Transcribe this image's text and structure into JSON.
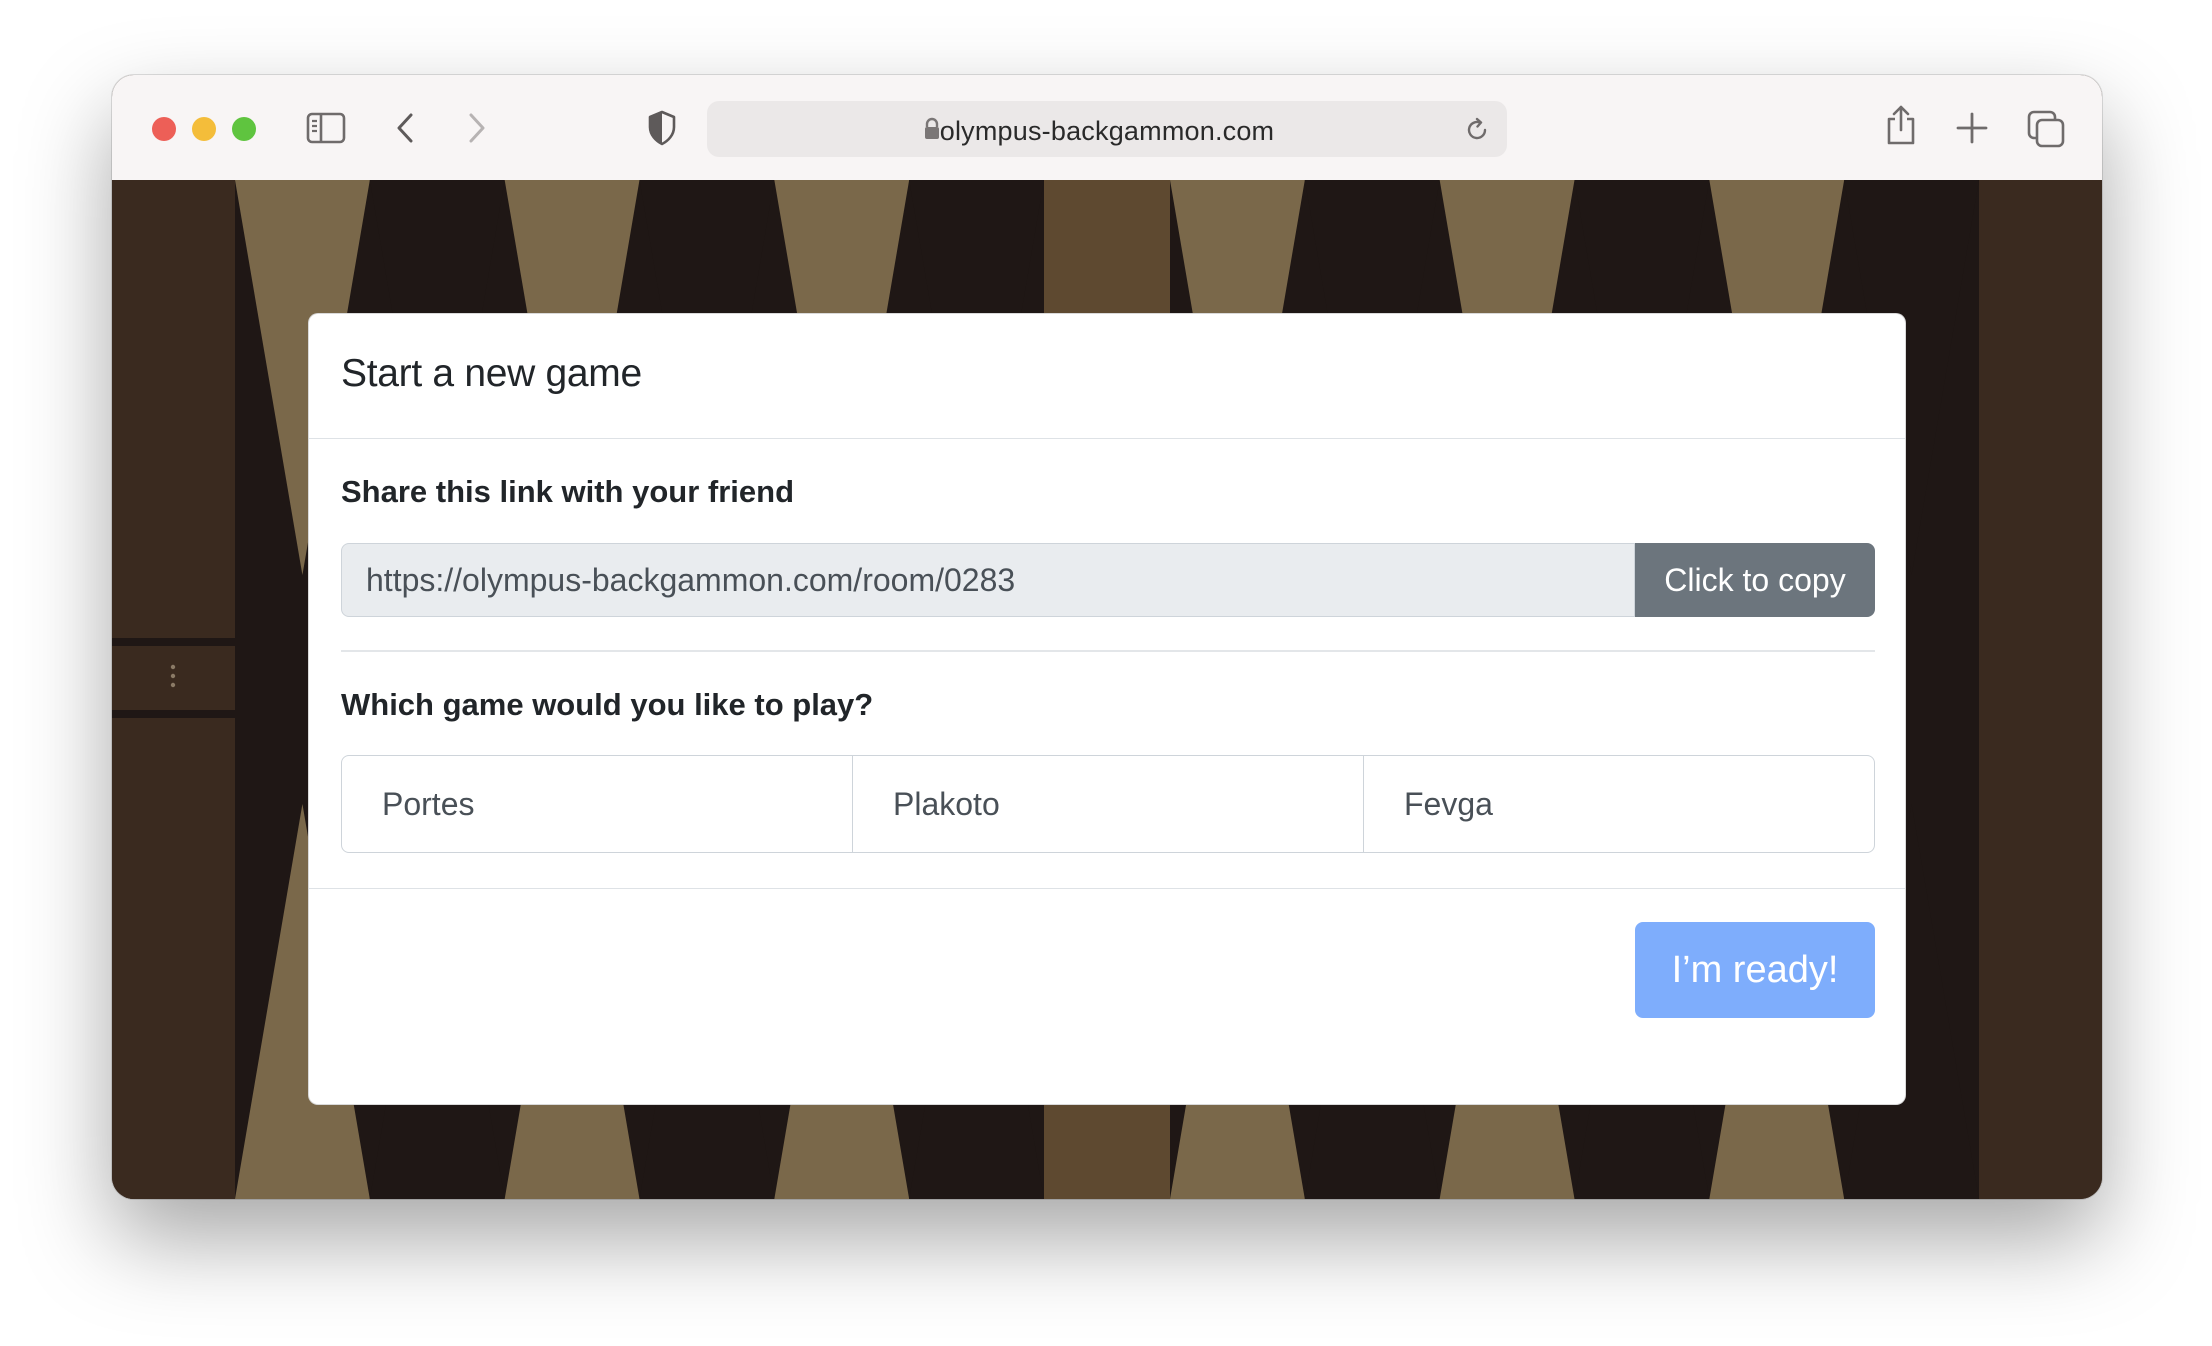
{
  "browser": {
    "url": "olympus-backgammon.com"
  },
  "dialog": {
    "title": "Start a new game",
    "share_label": "Share this link with your friend",
    "share_link": "https://olympus-backgammon.com/room/0283",
    "copy_button": "Click to copy",
    "game_question": "Which game would you like to play?",
    "game_options": [
      "Portes",
      "Plakoto",
      "Fevga"
    ],
    "ready_button": "I’m ready!"
  },
  "colors": {
    "board_light_point": "#7a684a",
    "board_dark_point": "#1f1715",
    "board_frame": "#3a2a1f",
    "board_bar": "#5e4930",
    "ready_button": "#7eadfc",
    "copy_button": "#6c757d"
  }
}
